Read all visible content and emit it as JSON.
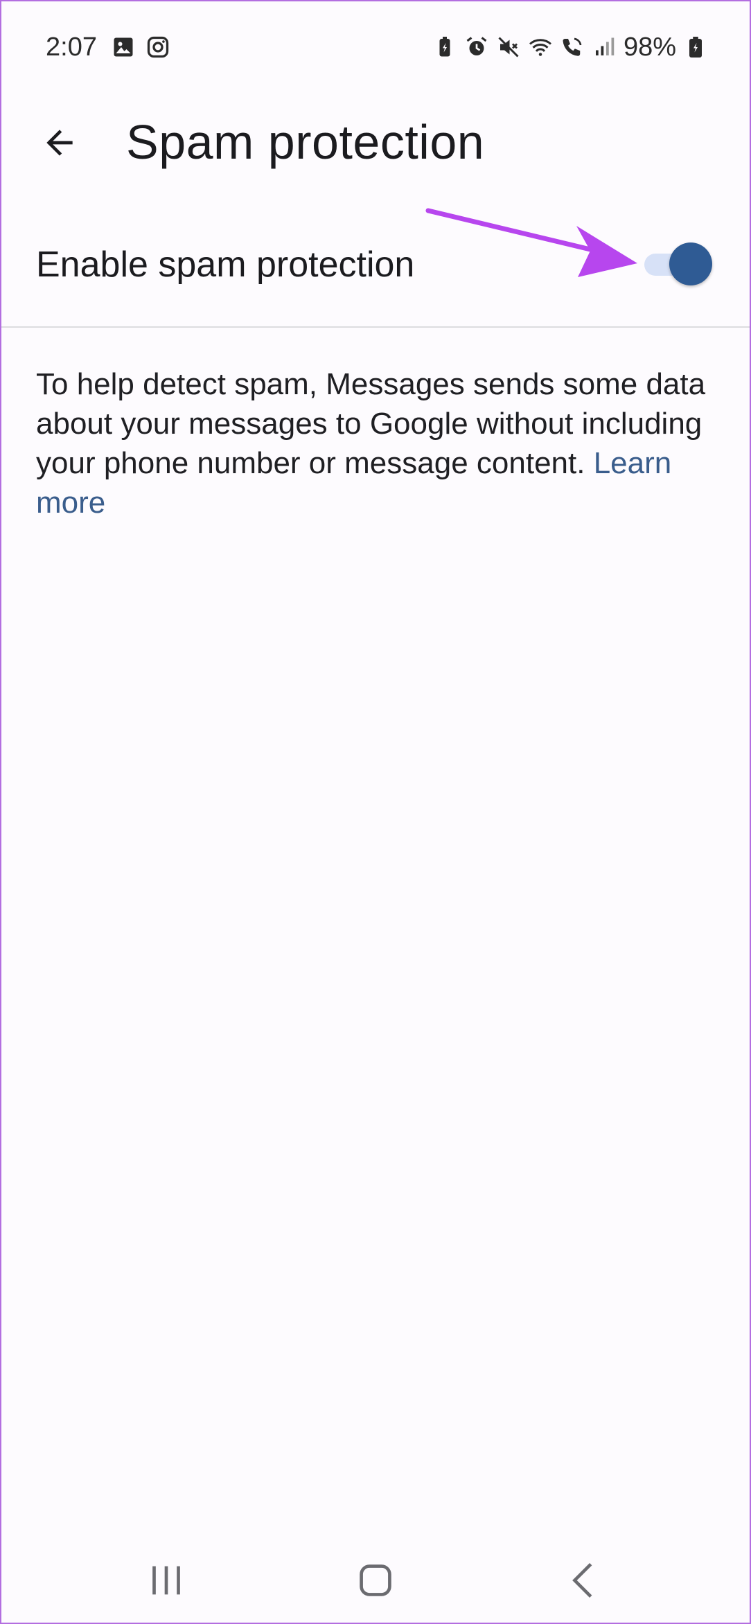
{
  "status_bar": {
    "time": "2:07",
    "battery": "98%",
    "icons_left": [
      "gallery-icon",
      "instagram-icon"
    ],
    "icons_right": [
      "battery-saver-icon",
      "alarm-icon",
      "mute-icon",
      "wifi-icon",
      "wifi-calling-icon",
      "signal-icon",
      "battery-icon"
    ]
  },
  "app_bar": {
    "title": "Spam protection",
    "back_icon": "arrow-back-icon"
  },
  "setting": {
    "label": "Enable spam protection",
    "enabled": true
  },
  "description": {
    "text": "To help detect spam, Messages sends some data about your messages to Google without including your phone number or message content.",
    "link": "Learn more"
  },
  "colors": {
    "accent": "#2f5b94",
    "track": "#d7e1f7",
    "link": "#3a5d8c",
    "annotation": "#b746ee"
  },
  "nav_bar": {
    "icons": [
      "recents-icon",
      "home-icon",
      "back-icon"
    ]
  }
}
